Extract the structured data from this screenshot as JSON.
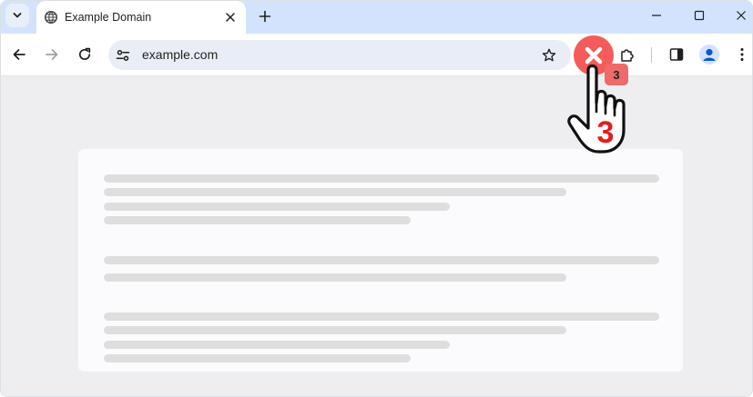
{
  "tab": {
    "title": "Example Domain"
  },
  "omnibox": {
    "url": "example.com"
  },
  "annotation": {
    "badge_count": "3",
    "hand_number": "3"
  },
  "icons": {
    "tab_menu": "chevron-down-icon",
    "favicon": "globe-icon",
    "tab_close": "close-icon",
    "new_tab": "plus-icon",
    "minimize": "minimize-icon",
    "maximize": "maximize-icon",
    "window_close": "close-icon",
    "back": "arrow-left-icon",
    "forward": "arrow-right-icon",
    "reload": "reload-icon",
    "site_info": "tune-icon",
    "bookmark": "star-icon",
    "extensions": "puzzle-icon",
    "side_panel": "side-panel-icon",
    "profile": "person-icon",
    "menu": "kebab-menu-icon"
  },
  "colors": {
    "tabstrip": "#d3e3fd",
    "omnibox": "#e9eef6",
    "content_bg": "#eeeef1",
    "card_bg": "#fbfbfd",
    "placeholder": "#dededf",
    "alert_red": "#f45b5b",
    "hand_number": "#e11d1d"
  }
}
